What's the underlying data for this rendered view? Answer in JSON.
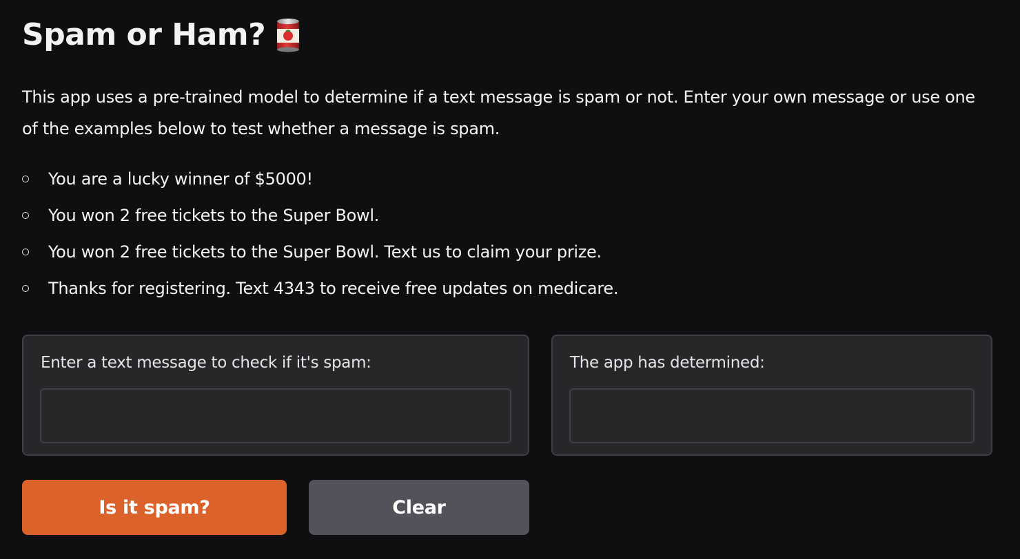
{
  "header": {
    "title": "Spam or Ham?",
    "title_icon": "tomato-can-icon"
  },
  "description": "This app uses a pre-trained model to determine if a text message is spam or not. Enter your own message or use one of the examples below to test whether a message is spam.",
  "examples": [
    "You are a lucky winner of $5000!",
    "You won 2 free tickets to the Super Bowl.",
    "You won 2 free tickets to the Super Bowl. Text us to claim your prize.",
    "Thanks for registering. Text 4343 to receive free updates on medicare."
  ],
  "input_panel": {
    "label": "Enter a text message to check if it's spam:",
    "value": "",
    "placeholder": ""
  },
  "output_panel": {
    "label": "The app has determined:",
    "value": ""
  },
  "buttons": {
    "submit_label": "Is it spam?",
    "clear_label": "Clear"
  },
  "colors": {
    "background": "#0f0f11",
    "panel": "#27272a",
    "primary_button": "#dc622c",
    "secondary_button": "#52525b"
  }
}
